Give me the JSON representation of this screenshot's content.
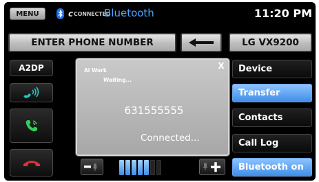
{
  "top_bar": {
    "menu_label": "MENU",
    "brand_text": "CONNECTED",
    "title": "Bluetooth",
    "time": "11:20 PM"
  },
  "entry_row": {
    "phone_placeholder": "ENTER PHONE NUMBER",
    "device_label": "LG VX9200"
  },
  "left_column": {
    "a2dp_label": "A2DP"
  },
  "right_menu": {
    "items": [
      {
        "label": "Device",
        "active": false
      },
      {
        "label": "Transfer",
        "active": true
      },
      {
        "label": "Contacts",
        "active": false
      },
      {
        "label": "Call Log",
        "active": false
      },
      {
        "label": "Bluetooth on",
        "active": true
      }
    ]
  },
  "popup": {
    "caller_name": "Al Work",
    "waiting_text": "Waiting...",
    "close_label": "X",
    "number": "631555555",
    "status": "Connected..."
  },
  "volume": {
    "level": 5,
    "max": 7
  },
  "colors": {
    "accent_blue": "#4ea3ff",
    "active_button": "#3f8ee8",
    "answer_green": "#2fd15a",
    "hangup_red": "#e0303a",
    "call_teal": "#29c7c0"
  },
  "icons": {
    "bluetooth": "bluetooth-icon",
    "backspace": "backspace-arrow-icon",
    "call_volume": "call-volume-icon",
    "answer": "answer-call-icon",
    "hangup": "hang-up-icon",
    "mic_minus": "mic-volume-down-icon",
    "mic_plus": "mic-volume-up-icon"
  }
}
